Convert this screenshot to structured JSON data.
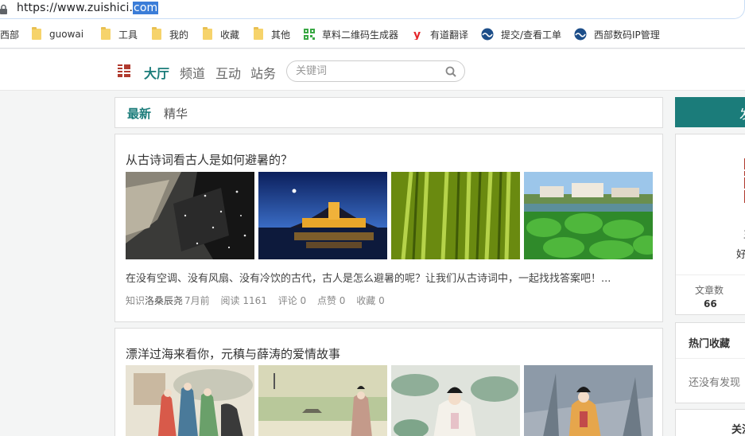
{
  "browser": {
    "url_prefix": "https://www.zuishici.",
    "url_selected": "com"
  },
  "bookmarks": [
    {
      "label": "西部",
      "icon": "folder-icon"
    },
    {
      "label": "guowai",
      "icon": "folder-icon"
    },
    {
      "label": "工具",
      "icon": "folder-icon"
    },
    {
      "label": "我的",
      "icon": "folder-icon"
    },
    {
      "label": "收藏",
      "icon": "folder-icon"
    },
    {
      "label": "其他",
      "icon": "folder-icon"
    },
    {
      "label": "草料二维码生成器",
      "icon": "qr-code-icon"
    },
    {
      "label": "有道翻译",
      "icon": "youdao-icon"
    },
    {
      "label": "提交/查看工单",
      "icon": "globe-icon"
    },
    {
      "label": "西部数码IP管理",
      "icon": "globe-icon"
    }
  ],
  "header": {
    "nav": [
      "大厅",
      "频道",
      "互动",
      "站务"
    ],
    "search_placeholder": "关键词"
  },
  "tabs": [
    "最新",
    "精华"
  ],
  "articles": [
    {
      "title": "从古诗词看古人是如何避暑的？",
      "summary": "在没有空调、没有风扇、没有冷饮的古代，古人是怎么避暑的呢？让我们从古诗词中，一起找找答案吧！...",
      "category": "知识",
      "author": "洛桑辰尧",
      "time": "7月前",
      "reads": "阅读 1161",
      "comments": "评论 0",
      "likes": "点赞 0",
      "favorites": "收藏 0"
    },
    {
      "title": "漂洋过海来看你，元稹与薛涛的爱情故事"
    }
  ],
  "sidebar": {
    "post_button": "发",
    "profile_mini1": "王",
    "profile_mini2": "好",
    "stat_label": "文章数",
    "stat_value": "66",
    "hot_title": "热门收藏",
    "hot_empty": "还没有发现",
    "follow_title": "关注"
  },
  "colors": {
    "accent": "#1b7c7a",
    "selection": "#3b7dd8"
  }
}
